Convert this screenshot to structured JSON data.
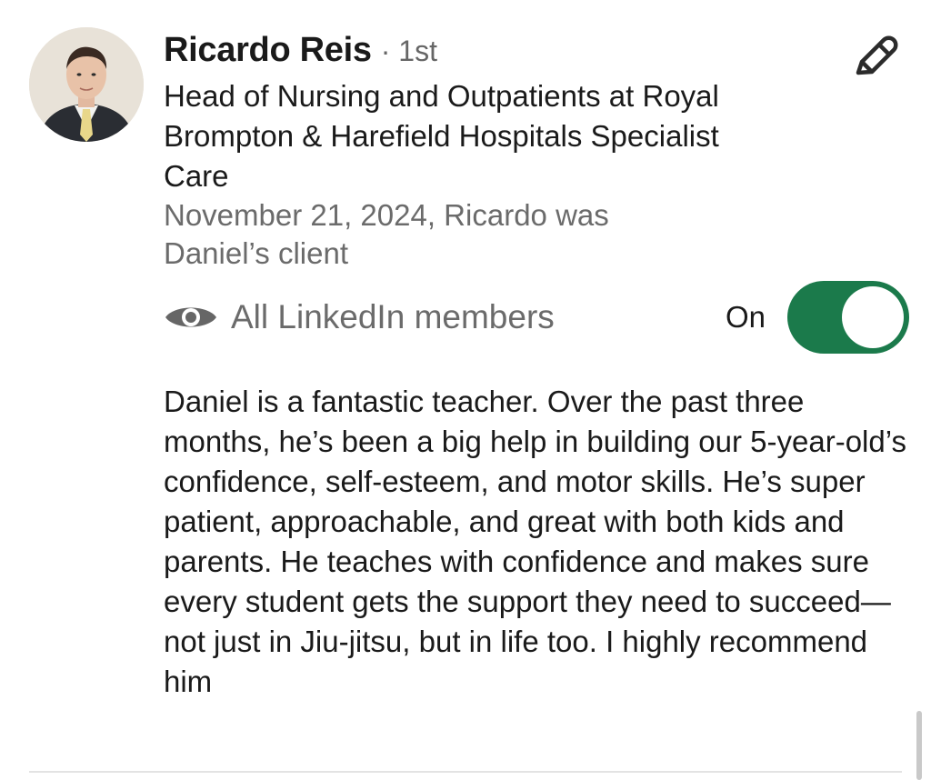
{
  "recommender": {
    "name": "Ricardo Reis",
    "degree": "· 1st",
    "headline": "Head of Nursing and Outpatients at Royal Brompton & Harefield Hospitals Specialist Care",
    "meta": "November 21, 2024, Ricardo was Daniel’s client"
  },
  "visibility": {
    "icon": "eye-icon",
    "label": "All LinkedIn members",
    "toggle_label": "On",
    "toggle_on": true
  },
  "recommendation": {
    "text": "Daniel is a fantastic teacher. Over the past three months, he’s been a big help in building our 5-year-old’s confidence, self-esteem, and motor skills. He’s super patient, approachable, and great with both kids and parents. He teaches with confidence and makes sure every student gets the support they need to succeed—not just in Jiu-jitsu, but in life too. I highly recommend him"
  },
  "colors": {
    "toggle_on": "#1b7a4b",
    "muted_text": "#6b6b6b",
    "primary_text": "#1a1a1a"
  },
  "edit": {
    "icon": "pencil-icon"
  }
}
